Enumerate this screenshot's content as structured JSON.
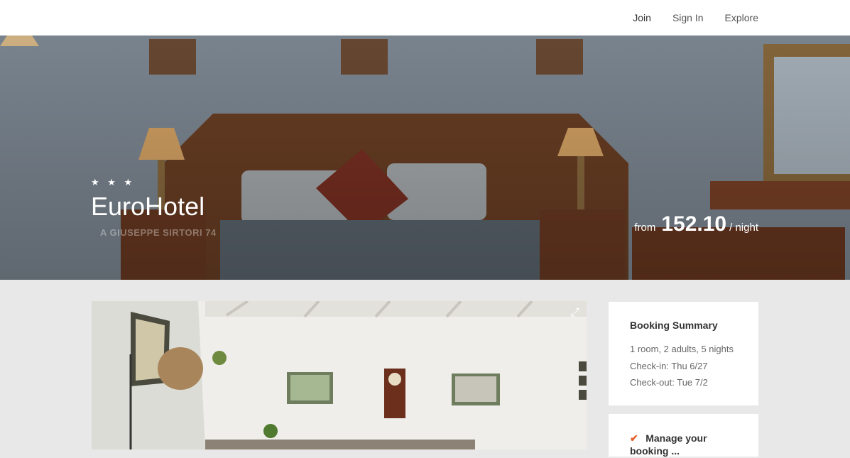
{
  "nav": {
    "items": [
      "Join",
      "Sign In",
      "Explore"
    ]
  },
  "hero": {
    "stars": "★ ★ ★",
    "name": "EuroHotel",
    "address": "A GIUSEPPE SIRTORI 74",
    "price_from": "from",
    "price": "152.10",
    "price_unit": "/ night"
  },
  "gallery": {
    "expand_icon": "expand-icon"
  },
  "summary": {
    "title": "Booking Summary",
    "line1": "1 room, 2 adults, 5 nights",
    "checkin": "Check-in: Thu 6/27",
    "checkout": "Check-out: Tue 7/2"
  },
  "manage": {
    "label": "Manage your booking ..."
  },
  "colors": {
    "accent": "#e8602c",
    "background": "#e8e8e8"
  }
}
